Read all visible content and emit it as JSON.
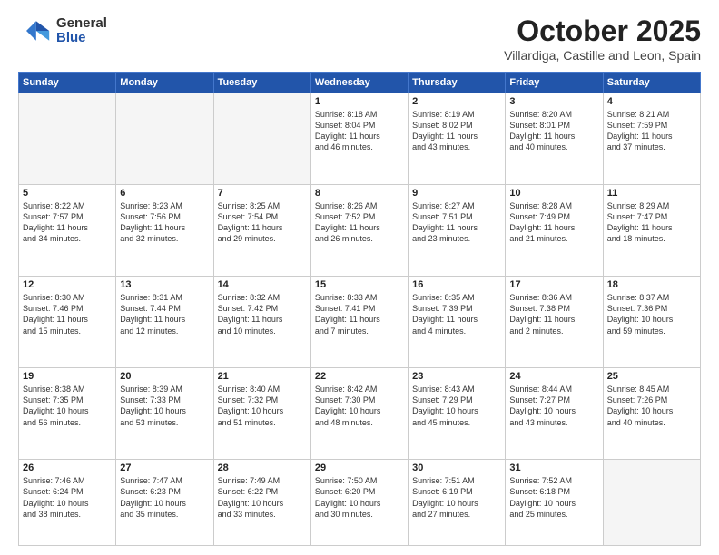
{
  "header": {
    "logo_general": "General",
    "logo_blue": "Blue",
    "month": "October 2025",
    "location": "Villardiga, Castille and Leon, Spain"
  },
  "days_of_week": [
    "Sunday",
    "Monday",
    "Tuesday",
    "Wednesday",
    "Thursday",
    "Friday",
    "Saturday"
  ],
  "weeks": [
    [
      {
        "day": "",
        "empty": true,
        "content": ""
      },
      {
        "day": "",
        "empty": true,
        "content": ""
      },
      {
        "day": "",
        "empty": true,
        "content": ""
      },
      {
        "day": "1",
        "empty": false,
        "content": "Sunrise: 8:18 AM\nSunset: 8:04 PM\nDaylight: 11 hours\nand 46 minutes."
      },
      {
        "day": "2",
        "empty": false,
        "content": "Sunrise: 8:19 AM\nSunset: 8:02 PM\nDaylight: 11 hours\nand 43 minutes."
      },
      {
        "day": "3",
        "empty": false,
        "content": "Sunrise: 8:20 AM\nSunset: 8:01 PM\nDaylight: 11 hours\nand 40 minutes."
      },
      {
        "day": "4",
        "empty": false,
        "content": "Sunrise: 8:21 AM\nSunset: 7:59 PM\nDaylight: 11 hours\nand 37 minutes."
      }
    ],
    [
      {
        "day": "5",
        "empty": false,
        "content": "Sunrise: 8:22 AM\nSunset: 7:57 PM\nDaylight: 11 hours\nand 34 minutes."
      },
      {
        "day": "6",
        "empty": false,
        "content": "Sunrise: 8:23 AM\nSunset: 7:56 PM\nDaylight: 11 hours\nand 32 minutes."
      },
      {
        "day": "7",
        "empty": false,
        "content": "Sunrise: 8:25 AM\nSunset: 7:54 PM\nDaylight: 11 hours\nand 29 minutes."
      },
      {
        "day": "8",
        "empty": false,
        "content": "Sunrise: 8:26 AM\nSunset: 7:52 PM\nDaylight: 11 hours\nand 26 minutes."
      },
      {
        "day": "9",
        "empty": false,
        "content": "Sunrise: 8:27 AM\nSunset: 7:51 PM\nDaylight: 11 hours\nand 23 minutes."
      },
      {
        "day": "10",
        "empty": false,
        "content": "Sunrise: 8:28 AM\nSunset: 7:49 PM\nDaylight: 11 hours\nand 21 minutes."
      },
      {
        "day": "11",
        "empty": false,
        "content": "Sunrise: 8:29 AM\nSunset: 7:47 PM\nDaylight: 11 hours\nand 18 minutes."
      }
    ],
    [
      {
        "day": "12",
        "empty": false,
        "content": "Sunrise: 8:30 AM\nSunset: 7:46 PM\nDaylight: 11 hours\nand 15 minutes."
      },
      {
        "day": "13",
        "empty": false,
        "content": "Sunrise: 8:31 AM\nSunset: 7:44 PM\nDaylight: 11 hours\nand 12 minutes."
      },
      {
        "day": "14",
        "empty": false,
        "content": "Sunrise: 8:32 AM\nSunset: 7:42 PM\nDaylight: 11 hours\nand 10 minutes."
      },
      {
        "day": "15",
        "empty": false,
        "content": "Sunrise: 8:33 AM\nSunset: 7:41 PM\nDaylight: 11 hours\nand 7 minutes."
      },
      {
        "day": "16",
        "empty": false,
        "content": "Sunrise: 8:35 AM\nSunset: 7:39 PM\nDaylight: 11 hours\nand 4 minutes."
      },
      {
        "day": "17",
        "empty": false,
        "content": "Sunrise: 8:36 AM\nSunset: 7:38 PM\nDaylight: 11 hours\nand 2 minutes."
      },
      {
        "day": "18",
        "empty": false,
        "content": "Sunrise: 8:37 AM\nSunset: 7:36 PM\nDaylight: 10 hours\nand 59 minutes."
      }
    ],
    [
      {
        "day": "19",
        "empty": false,
        "content": "Sunrise: 8:38 AM\nSunset: 7:35 PM\nDaylight: 10 hours\nand 56 minutes."
      },
      {
        "day": "20",
        "empty": false,
        "content": "Sunrise: 8:39 AM\nSunset: 7:33 PM\nDaylight: 10 hours\nand 53 minutes."
      },
      {
        "day": "21",
        "empty": false,
        "content": "Sunrise: 8:40 AM\nSunset: 7:32 PM\nDaylight: 10 hours\nand 51 minutes."
      },
      {
        "day": "22",
        "empty": false,
        "content": "Sunrise: 8:42 AM\nSunset: 7:30 PM\nDaylight: 10 hours\nand 48 minutes."
      },
      {
        "day": "23",
        "empty": false,
        "content": "Sunrise: 8:43 AM\nSunset: 7:29 PM\nDaylight: 10 hours\nand 45 minutes."
      },
      {
        "day": "24",
        "empty": false,
        "content": "Sunrise: 8:44 AM\nSunset: 7:27 PM\nDaylight: 10 hours\nand 43 minutes."
      },
      {
        "day": "25",
        "empty": false,
        "content": "Sunrise: 8:45 AM\nSunset: 7:26 PM\nDaylight: 10 hours\nand 40 minutes."
      }
    ],
    [
      {
        "day": "26",
        "empty": false,
        "content": "Sunrise: 7:46 AM\nSunset: 6:24 PM\nDaylight: 10 hours\nand 38 minutes."
      },
      {
        "day": "27",
        "empty": false,
        "content": "Sunrise: 7:47 AM\nSunset: 6:23 PM\nDaylight: 10 hours\nand 35 minutes."
      },
      {
        "day": "28",
        "empty": false,
        "content": "Sunrise: 7:49 AM\nSunset: 6:22 PM\nDaylight: 10 hours\nand 33 minutes."
      },
      {
        "day": "29",
        "empty": false,
        "content": "Sunrise: 7:50 AM\nSunset: 6:20 PM\nDaylight: 10 hours\nand 30 minutes."
      },
      {
        "day": "30",
        "empty": false,
        "content": "Sunrise: 7:51 AM\nSunset: 6:19 PM\nDaylight: 10 hours\nand 27 minutes."
      },
      {
        "day": "31",
        "empty": false,
        "content": "Sunrise: 7:52 AM\nSunset: 6:18 PM\nDaylight: 10 hours\nand 25 minutes."
      },
      {
        "day": "",
        "empty": true,
        "content": ""
      }
    ]
  ]
}
